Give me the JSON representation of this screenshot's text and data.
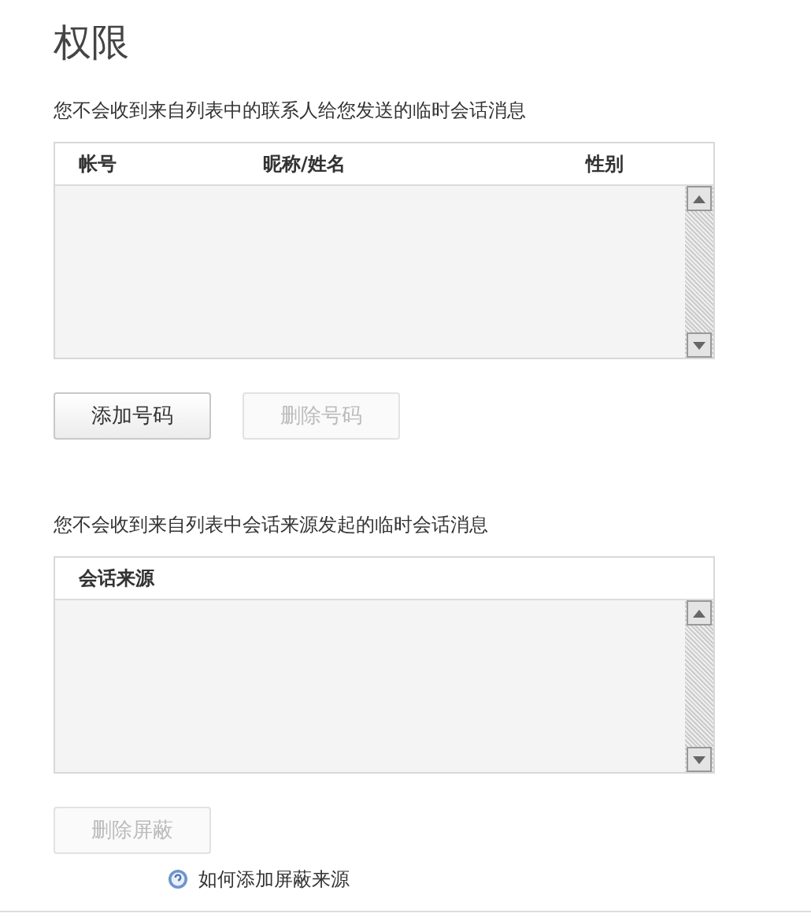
{
  "title": "权限",
  "sections": [
    {
      "description": "您不会收到来自列表中的联系人给您发送的临时会话消息",
      "table": {
        "columns": [
          "帐号",
          "昵称/姓名",
          "性别"
        ]
      },
      "buttons": [
        {
          "label": "添加号码",
          "disabled": false
        },
        {
          "label": "删除号码",
          "disabled": true
        }
      ]
    },
    {
      "description": "您不会收到来自列表中会话来源发起的临时会话消息",
      "table": {
        "columns": [
          "会话来源"
        ]
      },
      "buttons": [
        {
          "label": "删除屏蔽",
          "disabled": true
        }
      ],
      "help_link": "如何添加屏蔽来源"
    }
  ]
}
